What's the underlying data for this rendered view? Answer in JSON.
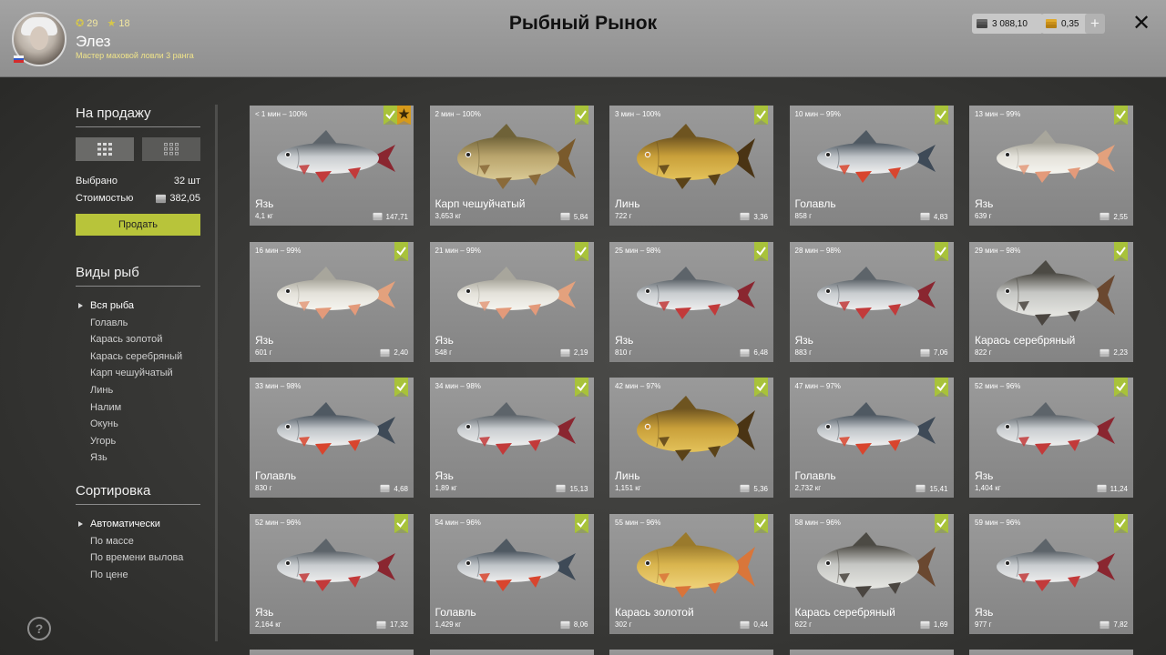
{
  "header": {
    "title": "Рыбный Рынок",
    "user": {
      "name": "Элез",
      "rank": "Мастер маховой ловли 3 ранга",
      "level": "29",
      "stars": "18"
    },
    "silver": "3 088,10",
    "gold": "0,35"
  },
  "sidebar": {
    "sale_title": "На продажу",
    "selected_label": "Выбрано",
    "selected_value": "32 шт",
    "cost_label": "Стоимостью",
    "cost_value": "382,05",
    "sell_label": "Продать",
    "species_title": "Виды рыб",
    "species": [
      "Вся рыба",
      "Голавль",
      "Карась золотой",
      "Карась серебряный",
      "Карп чешуйчатый",
      "Линь",
      "Налим",
      "Окунь",
      "Угорь",
      "Язь"
    ],
    "sort_title": "Сортировка",
    "sort_options": [
      "Автоматически",
      "По массе",
      "По времени вылова",
      "По цене"
    ],
    "help": "?"
  },
  "colors": {
    "accent": "#b8c43a",
    "check": "#a8c23a",
    "star": "#d79a1a"
  },
  "fish": [
    {
      "time": "< 1 мин – 100%",
      "name": "Язь",
      "weight": "4,1 кг",
      "price": "147,71",
      "starred": true,
      "type": "ide"
    },
    {
      "time": "2 мин – 100%",
      "name": "Карп чешуйчатый",
      "weight": "3,653 кг",
      "price": "5,84",
      "starred": false,
      "type": "carp"
    },
    {
      "time": "3 мин – 100%",
      "name": "Линь",
      "weight": "722 г",
      "price": "3,36",
      "starred": false,
      "type": "tench"
    },
    {
      "time": "10 мин – 99%",
      "name": "Голавль",
      "weight": "858 г",
      "price": "4,83",
      "starred": false,
      "type": "chub"
    },
    {
      "time": "13 мин – 99%",
      "name": "Язь",
      "weight": "639 г",
      "price": "2,55",
      "starred": false,
      "type": "ide-pale"
    },
    {
      "time": "16 мин – 99%",
      "name": "Язь",
      "weight": "601 г",
      "price": "2,40",
      "starred": false,
      "type": "ide-pale"
    },
    {
      "time": "21 мин – 99%",
      "name": "Язь",
      "weight": "548 г",
      "price": "2,19",
      "starred": false,
      "type": "ide-pale"
    },
    {
      "time": "25 мин – 98%",
      "name": "Язь",
      "weight": "810 г",
      "price": "6,48",
      "starred": false,
      "type": "ide"
    },
    {
      "time": "28 мин – 98%",
      "name": "Язь",
      "weight": "883 г",
      "price": "7,06",
      "starred": false,
      "type": "ide"
    },
    {
      "time": "29 мин – 98%",
      "name": "Карась серебряный",
      "weight": "822 г",
      "price": "2,23",
      "starred": false,
      "type": "silver-carp"
    },
    {
      "time": "33 мин – 98%",
      "name": "Голавль",
      "weight": "830 г",
      "price": "4,68",
      "starred": false,
      "type": "chub"
    },
    {
      "time": "34 мин – 98%",
      "name": "Язь",
      "weight": "1,89 кг",
      "price": "15,13",
      "starred": false,
      "type": "ide"
    },
    {
      "time": "42 мин – 97%",
      "name": "Линь",
      "weight": "1,151 кг",
      "price": "5,36",
      "starred": false,
      "type": "tench"
    },
    {
      "time": "47 мин – 97%",
      "name": "Голавль",
      "weight": "2,732 кг",
      "price": "15,41",
      "starred": false,
      "type": "chub"
    },
    {
      "time": "52 мин – 96%",
      "name": "Язь",
      "weight": "1,404 кг",
      "price": "11,24",
      "starred": false,
      "type": "ide"
    },
    {
      "time": "52 мин – 96%",
      "name": "Язь",
      "weight": "2,164 кг",
      "price": "17,32",
      "starred": false,
      "type": "ide"
    },
    {
      "time": "54 мин – 96%",
      "name": "Голавль",
      "weight": "1,429 кг",
      "price": "8,06",
      "starred": false,
      "type": "chub"
    },
    {
      "time": "55 мин – 96%",
      "name": "Карась золотой",
      "weight": "302 г",
      "price": "0,44",
      "starred": false,
      "type": "gold-carp"
    },
    {
      "time": "58 мин – 96%",
      "name": "Карась серебряный",
      "weight": "622 г",
      "price": "1,69",
      "starred": false,
      "type": "silver-carp"
    },
    {
      "time": "59 мин – 96%",
      "name": "Язь",
      "weight": "977 г",
      "price": "7,82",
      "starred": false,
      "type": "ide"
    }
  ]
}
